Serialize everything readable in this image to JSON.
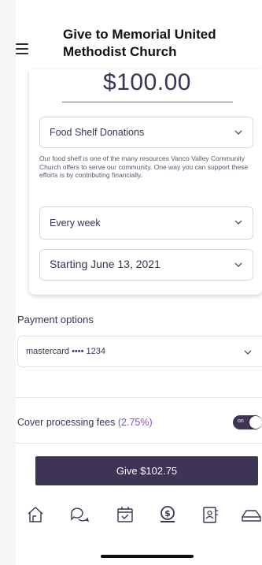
{
  "header": {
    "title": "Give to Memorial United Methodist Church",
    "menu_icon": "hamburger-menu-icon"
  },
  "gift": {
    "amount": "$100.00",
    "fund": "Food Shelf Donations",
    "fund_description": "Our food shelf is one of the many resources Vanco Valley Community Church offers to serve our community. One way you can support these efforts is by contributing financially.",
    "frequency": "Every week",
    "start_date": "Starting June 13, 2021"
  },
  "payment": {
    "title": "Payment options",
    "method": "mastercard •••• 1234"
  },
  "fees": {
    "label": "Cover processing fees",
    "percent": "(2.75%)",
    "toggle_text": "on",
    "enabled": true
  },
  "give_button": "Give $102.75",
  "tabbar": {
    "icons": [
      "home-icon",
      "chat-icon",
      "calendar-icon",
      "give-icon",
      "directory-icon",
      "more-icon"
    ],
    "active": "give-icon"
  },
  "colors": {
    "primary": "#3d3456",
    "accent": "#8a4fc9",
    "text": "#3b3355"
  }
}
